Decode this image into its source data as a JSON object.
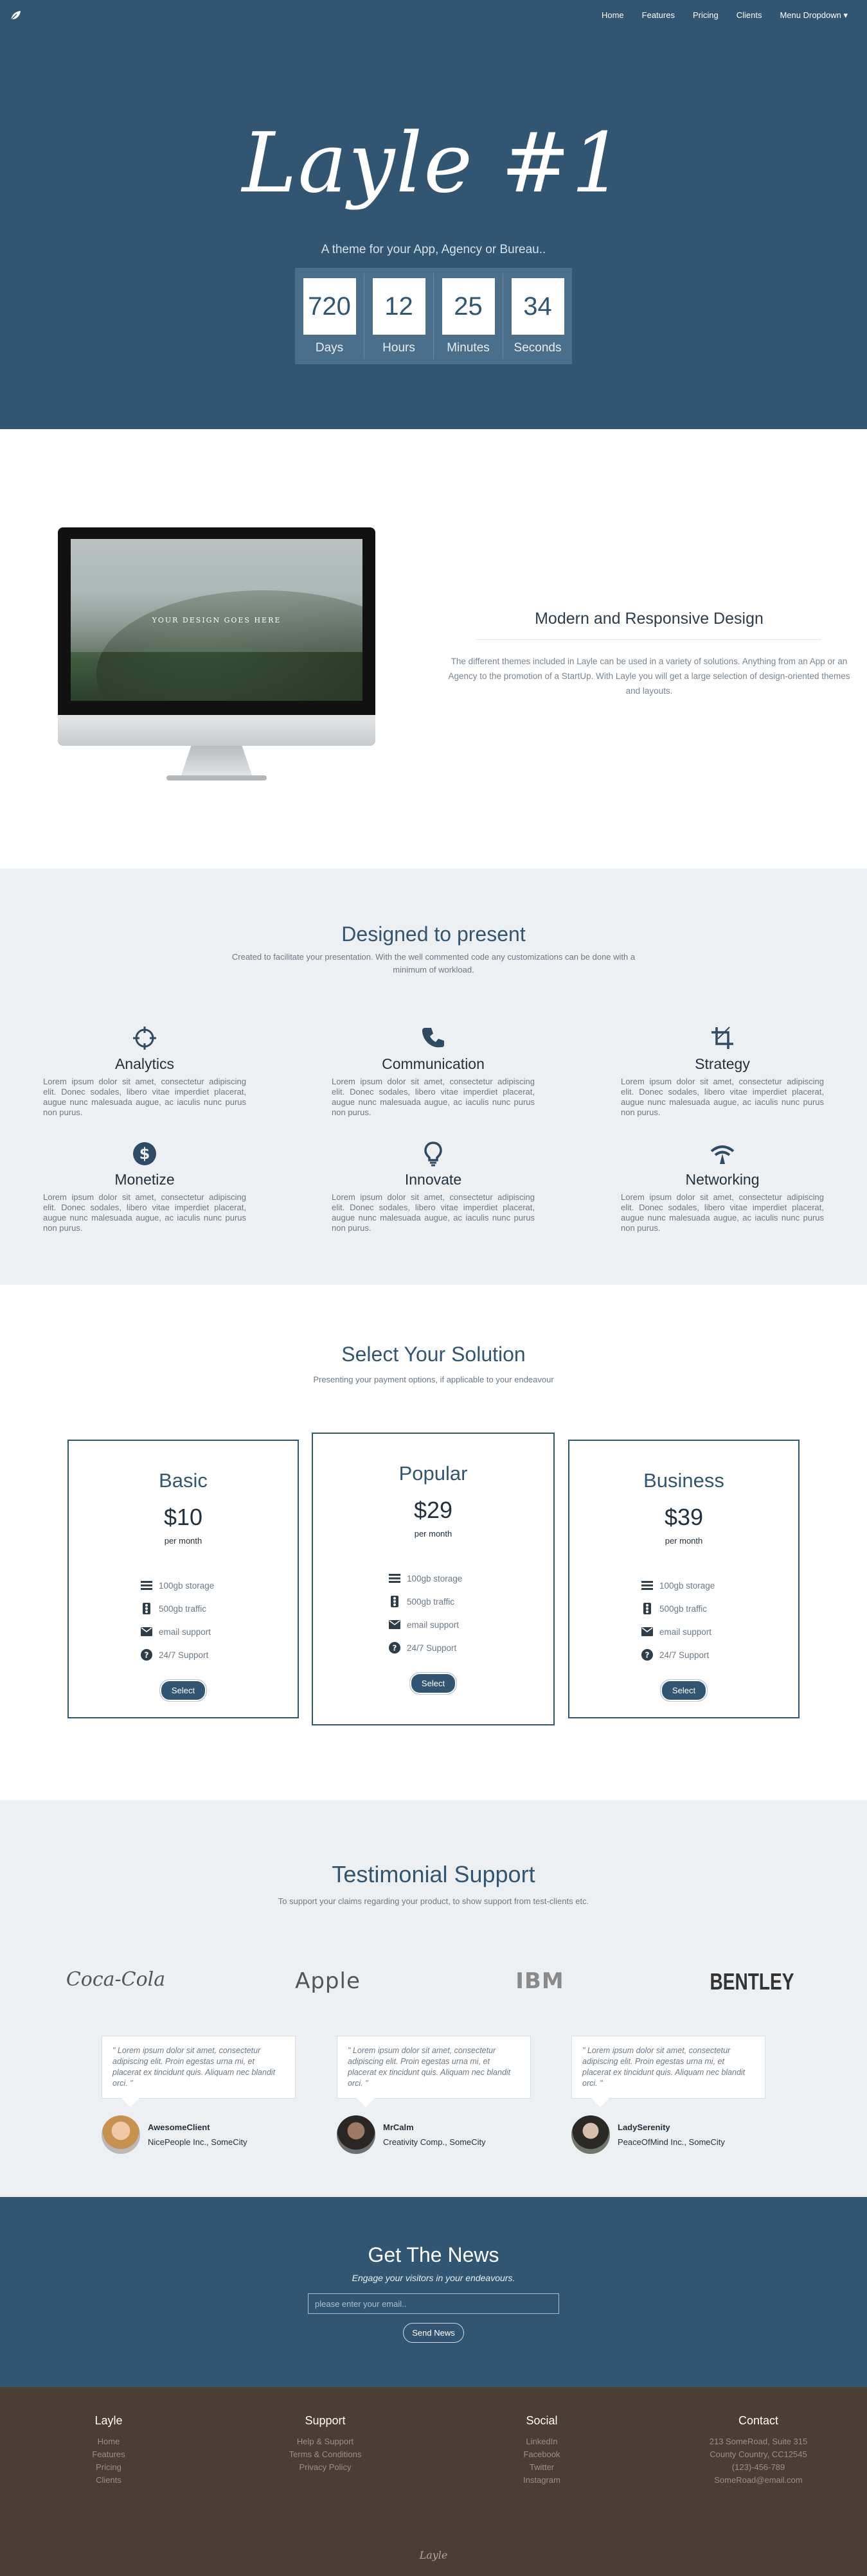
{
  "nav": {
    "items": [
      "Home",
      "Features",
      "Pricing",
      "Clients",
      "Menu Dropdown ▾"
    ]
  },
  "hero": {
    "title": "Layle #1",
    "tagline": "A theme for your App, Agency or Bureau..",
    "countdown": [
      {
        "value": "720",
        "label": "Days"
      },
      {
        "value": "12",
        "label": "Hours"
      },
      {
        "value": "25",
        "label": "Minutes"
      },
      {
        "value": "34",
        "label": "Seconds"
      }
    ]
  },
  "design": {
    "screen_text": "YOUR DESIGN GOES HERE",
    "title": "Modern and Responsive Design",
    "body": "The different themes included in Layle can be used in a variety of solutions. Anything from an App or an Agency to the promotion of a StartUp. With Layle you will get a large selection of design-oriented themes and layouts."
  },
  "features": {
    "title": "Designed to present",
    "subtitle": "Created to facilitate your presentation. With the well commented code any customizations can be done with a minimum of workload.",
    "items": [
      {
        "icon": "crosshair-icon",
        "title": "Analytics",
        "text": "Lorem ipsum dolor sit amet, consectetur adipiscing elit. Donec sodales, libero vitae imperdiet placerat, augue nunc malesuada augue, ac iaculis nunc purus non purus."
      },
      {
        "icon": "phone-icon",
        "title": "Communication",
        "text": "Lorem ipsum dolor sit amet, consectetur adipiscing elit. Donec sodales, libero vitae imperdiet placerat, augue nunc malesuada augue, ac iaculis nunc purus non purus."
      },
      {
        "icon": "crop-icon",
        "title": "Strategy",
        "text": "Lorem ipsum dolor sit amet, consectetur adipiscing elit. Donec sodales, libero vitae imperdiet placerat, augue nunc malesuada augue, ac iaculis nunc purus non purus."
      },
      {
        "icon": "dollar-icon",
        "title": "Monetize",
        "text": "Lorem ipsum dolor sit amet, consectetur adipiscing elit. Donec sodales, libero vitae imperdiet placerat, augue nunc malesuada augue, ac iaculis nunc purus non purus."
      },
      {
        "icon": "lightbulb-icon",
        "title": "Innovate",
        "text": "Lorem ipsum dolor sit amet, consectetur adipiscing elit. Donec sodales, libero vitae imperdiet placerat, augue nunc malesuada augue, ac iaculis nunc purus non purus."
      },
      {
        "icon": "network-icon",
        "title": "Networking",
        "text": "Lorem ipsum dolor sit amet, consectetur adipiscing elit. Donec sodales, libero vitae imperdiet placerat, augue nunc malesuada augue, ac iaculis nunc purus non purus."
      }
    ]
  },
  "pricing": {
    "title": "Select Your Solution",
    "subtitle": "Presenting your payment options, if applicable to your endeavour",
    "plans": [
      {
        "name": "Basic",
        "price": "$10",
        "period": "per month",
        "features": [
          "100gb storage",
          "500gb traffic",
          "email support",
          "24/7 Support"
        ],
        "button": "Select"
      },
      {
        "name": "Popular",
        "price": "$29",
        "period": "per month",
        "features": [
          "100gb storage",
          "500gb traffic",
          "email support",
          "24/7 Support"
        ],
        "button": "Select"
      },
      {
        "name": "Business",
        "price": "$39",
        "period": "per month",
        "features": [
          "100gb storage",
          "500gb traffic",
          "email support",
          "24/7 Support"
        ],
        "button": "Select"
      }
    ]
  },
  "testimonials": {
    "title": "Testimonial Support",
    "subtitle": "To support your claims regarding your product, to show support from test-clients etc.",
    "brands": [
      "Coca-Cola",
      "Apple",
      "IBM",
      "BENTLEY"
    ],
    "items": [
      {
        "quote": "\" Lorem ipsum dolor sit amet, consectetur adipiscing elit. Proin egestas urna mi, et placerat ex tincidunt quis. Aliquam nec blandit orci. \"",
        "name": "AwesomeClient",
        "company": "NicePeople Inc., SomeCity"
      },
      {
        "quote": "\" Lorem ipsum dolor sit amet, consectetur adipiscing elit. Proin egestas urna mi, et placerat ex tincidunt quis. Aliquam nec blandit orci. \"",
        "name": "MrCalm",
        "company": "Creativity Comp., SomeCity"
      },
      {
        "quote": "\" Lorem ipsum dolor sit amet, consectetur adipiscing elit. Proin egestas urna mi, et placerat ex tincidunt quis. Aliquam nec blandit orci. \"",
        "name": "LadySerenity",
        "company": "PeaceOfMind Inc., SomeCity"
      }
    ]
  },
  "news": {
    "title": "Get The News",
    "subtitle": "Engage your visitors in your endeavours.",
    "placeholder": "please enter your email..",
    "button": "Send News"
  },
  "footer": {
    "columns": [
      {
        "title": "Layle",
        "items": [
          "Home",
          "Features",
          "Pricing",
          "Clients"
        ]
      },
      {
        "title": "Support",
        "items": [
          "Help & Support",
          "Terms & Conditions",
          "Privacy Policy"
        ]
      },
      {
        "title": "Social",
        "items": [
          "LinkedIn",
          "Facebook",
          "Twitter",
          "Instagram"
        ]
      },
      {
        "title": "Contact",
        "items": [
          "213 SomeRoad, Suite 315",
          "County Country, CC12545",
          "(123)-456-789",
          "SomeRoad@email.com"
        ]
      }
    ],
    "logo": "Layle"
  },
  "colors": {
    "primary": "#325671",
    "background_light": "#ecf0f3",
    "footer": "#4b3e33"
  }
}
